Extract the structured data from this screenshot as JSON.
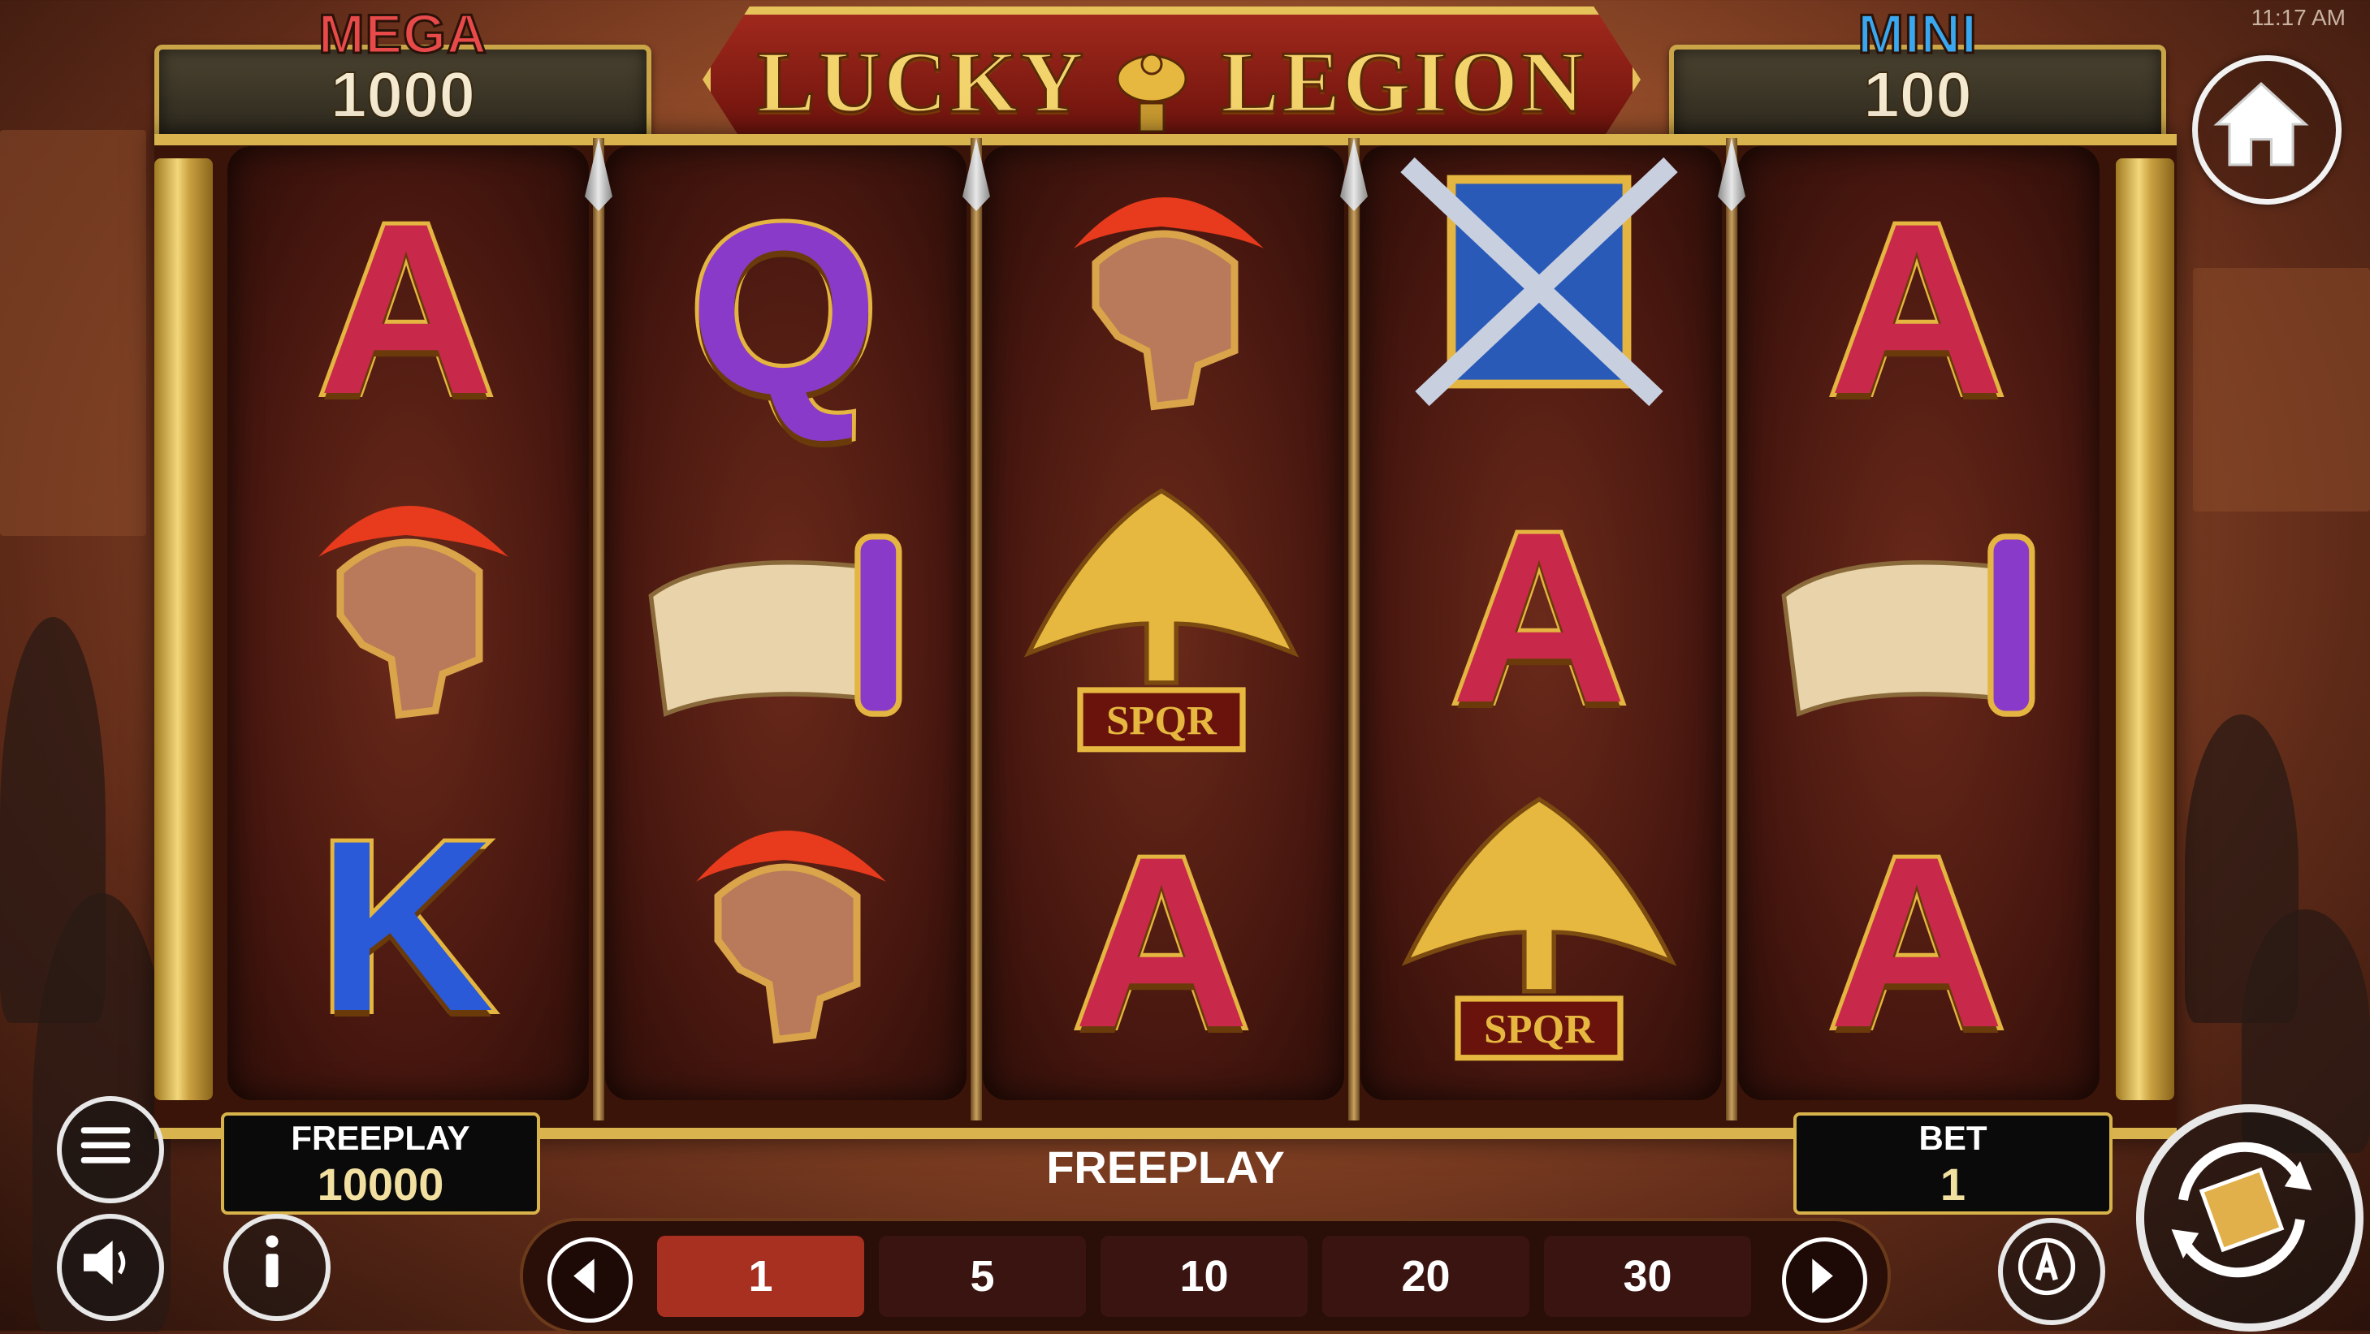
{
  "status": {
    "time": "11:17 AM"
  },
  "game": {
    "title_left": "LUCKY",
    "title_right": "LEGION"
  },
  "jackpots": {
    "mega": {
      "label": "MEGA",
      "value": "1000"
    },
    "mini": {
      "label": "MINI",
      "value": "100"
    }
  },
  "reels": [
    [
      "A",
      "helmet",
      "K"
    ],
    [
      "Q",
      "scroll",
      "helmet"
    ],
    [
      "helmet",
      "eagle",
      "A"
    ],
    [
      "swords",
      "A",
      "eagle"
    ],
    [
      "A",
      "scroll",
      "A"
    ]
  ],
  "eagle_banner_text": "SPQR",
  "panels": {
    "freeplay": {
      "label": "FREEPLAY",
      "value": "10000"
    },
    "bet": {
      "label": "BET",
      "value": "1"
    }
  },
  "message": "FREEPLAY",
  "bet_options": [
    "1",
    "5",
    "10",
    "20",
    "30"
  ],
  "selected_bet": "1",
  "colors": {
    "gold": "#d9b44e",
    "banner_red": "#a0281c",
    "mega": "#e84a4a",
    "mini": "#3aa8f0"
  }
}
